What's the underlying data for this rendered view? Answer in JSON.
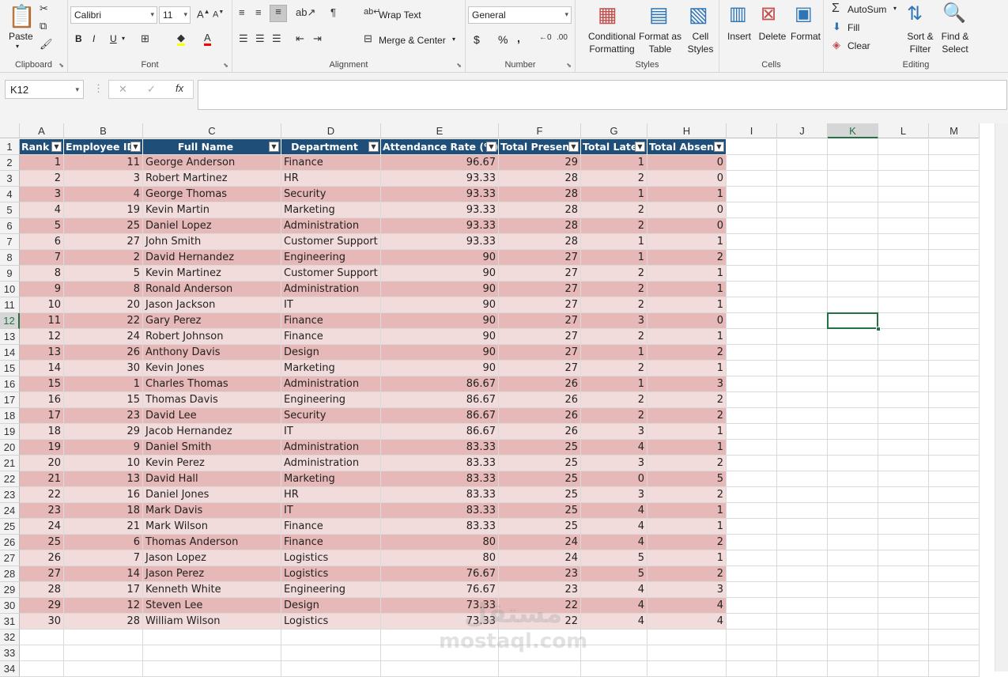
{
  "ribbon": {
    "clipboard": {
      "paste": "Paste",
      "label": "Clipboard"
    },
    "font": {
      "name": "Calibri",
      "size": "11",
      "label": "Font",
      "bold": "B",
      "italic": "I",
      "underline": "U"
    },
    "alignment": {
      "wrap_text": "Wrap Text",
      "merge_center": "Merge & Center",
      "label": "Alignment"
    },
    "number": {
      "format": "General",
      "currency": "$",
      "percent": "%",
      "comma": ",",
      "label": "Number"
    },
    "styles": {
      "conditional": "Conditional",
      "conditional2": "Formatting",
      "format_as": "Format as",
      "format_as2": "Table",
      "cell": "Cell",
      "cell2": "Styles",
      "label": "Styles"
    },
    "cells": {
      "insert": "Insert",
      "delete": "Delete",
      "format": "Format",
      "label": "Cells"
    },
    "editing": {
      "autosum": "AutoSum",
      "fill": "Fill",
      "clear": "Clear",
      "sort": "Sort &",
      "sort2": "Filter",
      "find": "Find &",
      "find2": "Select",
      "label": "Editing"
    }
  },
  "formula_bar": {
    "name_box": "K12",
    "fx": "fx",
    "value": ""
  },
  "columns": [
    "A",
    "B",
    "C",
    "D",
    "E",
    "F",
    "G",
    "H",
    "I",
    "J",
    "K",
    "L",
    "M"
  ],
  "active_cell": {
    "col": "K",
    "row": 12
  },
  "headers": [
    "Rank",
    "Employee ID",
    "Full Name",
    "Department",
    "Attendance Rate (%)",
    "Total Present",
    "Total Late",
    "Total Absent"
  ],
  "rows": [
    [
      "1",
      "11",
      "George Anderson",
      "Finance",
      "96.67",
      "29",
      "1",
      "0"
    ],
    [
      "2",
      "3",
      "Robert Martinez",
      "HR",
      "93.33",
      "28",
      "2",
      "0"
    ],
    [
      "3",
      "4",
      "George Thomas",
      "Security",
      "93.33",
      "28",
      "1",
      "1"
    ],
    [
      "4",
      "19",
      "Kevin Martin",
      "Marketing",
      "93.33",
      "28",
      "2",
      "0"
    ],
    [
      "5",
      "25",
      "Daniel Lopez",
      "Administration",
      "93.33",
      "28",
      "2",
      "0"
    ],
    [
      "6",
      "27",
      "John Smith",
      "Customer Support",
      "93.33",
      "28",
      "1",
      "1"
    ],
    [
      "7",
      "2",
      "David Hernandez",
      "Engineering",
      "90",
      "27",
      "1",
      "2"
    ],
    [
      "8",
      "5",
      "Kevin Martinez",
      "Customer Support",
      "90",
      "27",
      "2",
      "1"
    ],
    [
      "9",
      "8",
      "Ronald Anderson",
      "Administration",
      "90",
      "27",
      "2",
      "1"
    ],
    [
      "10",
      "20",
      "Jason Jackson",
      "IT",
      "90",
      "27",
      "2",
      "1"
    ],
    [
      "11",
      "22",
      "Gary Perez",
      "Finance",
      "90",
      "27",
      "3",
      "0"
    ],
    [
      "12",
      "24",
      "Robert Johnson",
      "Finance",
      "90",
      "27",
      "2",
      "1"
    ],
    [
      "13",
      "26",
      "Anthony Davis",
      "Design",
      "90",
      "27",
      "1",
      "2"
    ],
    [
      "14",
      "30",
      "Kevin Jones",
      "Marketing",
      "90",
      "27",
      "2",
      "1"
    ],
    [
      "15",
      "1",
      "Charles Thomas",
      "Administration",
      "86.67",
      "26",
      "1",
      "3"
    ],
    [
      "16",
      "15",
      "Thomas Davis",
      "Engineering",
      "86.67",
      "26",
      "2",
      "2"
    ],
    [
      "17",
      "23",
      "David Lee",
      "Security",
      "86.67",
      "26",
      "2",
      "2"
    ],
    [
      "18",
      "29",
      "Jacob Hernandez",
      "IT",
      "86.67",
      "26",
      "3",
      "1"
    ],
    [
      "19",
      "9",
      "Daniel Smith",
      "Administration",
      "83.33",
      "25",
      "4",
      "1"
    ],
    [
      "20",
      "10",
      "Kevin Perez",
      "Administration",
      "83.33",
      "25",
      "3",
      "2"
    ],
    [
      "21",
      "13",
      "David Hall",
      "Marketing",
      "83.33",
      "25",
      "0",
      "5"
    ],
    [
      "22",
      "16",
      "Daniel Jones",
      "HR",
      "83.33",
      "25",
      "3",
      "2"
    ],
    [
      "23",
      "18",
      "Mark Davis",
      "IT",
      "83.33",
      "25",
      "4",
      "1"
    ],
    [
      "24",
      "21",
      "Mark Wilson",
      "Finance",
      "83.33",
      "25",
      "4",
      "1"
    ],
    [
      "25",
      "6",
      "Thomas Anderson",
      "Finance",
      "80",
      "24",
      "4",
      "2"
    ],
    [
      "26",
      "7",
      "Jason Lopez",
      "Logistics",
      "80",
      "24",
      "5",
      "1"
    ],
    [
      "27",
      "14",
      "Jason Perez",
      "Logistics",
      "76.67",
      "23",
      "5",
      "2"
    ],
    [
      "28",
      "17",
      "Kenneth White",
      "Engineering",
      "76.67",
      "23",
      "4",
      "3"
    ],
    [
      "29",
      "12",
      "Steven Lee",
      "Design",
      "73.33",
      "22",
      "4",
      "4"
    ],
    [
      "30",
      "28",
      "William Wilson",
      "Logistics",
      "73.33",
      "22",
      "4",
      "4"
    ]
  ],
  "row_count": 34,
  "watermark": {
    "arabic": "مستقل",
    "latin": "mostaql.com"
  },
  "colors": {
    "header_fill": "#1f4e78",
    "band_dark": "#e6b8b7",
    "band_light": "#f2dcdb",
    "selection": "#217346"
  }
}
